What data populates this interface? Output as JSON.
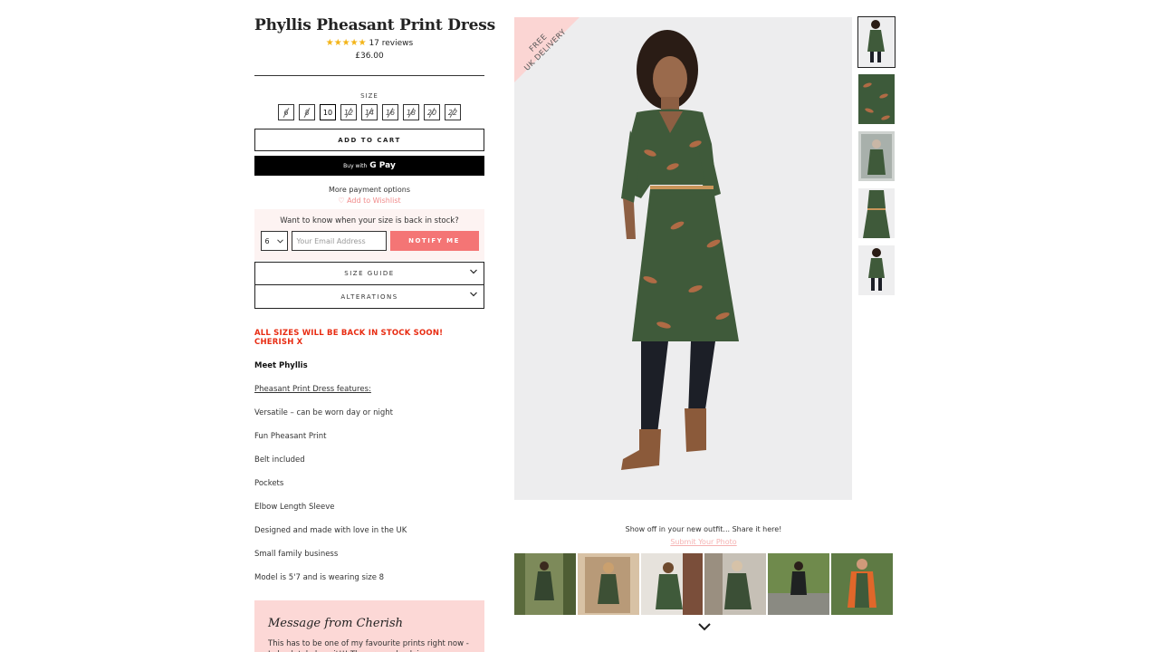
{
  "product": {
    "title": "Phyllis Pheasant Print Dress",
    "stars": "★★★★★",
    "reviews": "17 reviews",
    "price": "£36.00"
  },
  "size": {
    "label": "SIZE",
    "options": [
      {
        "label": "6",
        "available": false
      },
      {
        "label": "8",
        "available": false
      },
      {
        "label": "10",
        "available": true,
        "selected": true
      },
      {
        "label": "12",
        "available": false
      },
      {
        "label": "14",
        "available": false
      },
      {
        "label": "16",
        "available": false
      },
      {
        "label": "18",
        "available": false
      },
      {
        "label": "20",
        "available": false
      },
      {
        "label": "22",
        "available": false
      }
    ]
  },
  "buttons": {
    "add_to_cart": "ADD TO CART",
    "buy_with": "Buy with",
    "gpay": "G Pay",
    "more_payment": "More payment options",
    "wishlist": "♡ Add to Wishlist"
  },
  "notify": {
    "question": "Want to know when your size is back in stock?",
    "selected_size": "6",
    "email_placeholder": "Your Email Address",
    "button": "NOTIFY ME"
  },
  "accordions": {
    "size_guide": "SIZE GUIDE",
    "alterations": "ALTERATIONS"
  },
  "description": {
    "restock": "ALL SIZES WILL BE BACK IN STOCK SOON! CHERISH X",
    "meet": "Meet Phyllis",
    "features_heading": "Pheasant Print Dress features:",
    "features": [
      "Versatile – can be worn day or night",
      "Fun Pheasant Print",
      "Belt included",
      "Pockets",
      "Elbow Length Sleeve",
      "Designed and made with love in the UK",
      "Small family business",
      "Model is 5'7 and is wearing size 8"
    ]
  },
  "message": {
    "title": "Message from Cherish",
    "body": "This has to be one of my favourite prints right now - I absolutely love it!!! The green check is gorgeous and"
  },
  "banner": {
    "line1": "FREE",
    "line2": "UK DELIVERY"
  },
  "ugc": {
    "prompt": "Show off in your new outfit... Share it here!",
    "link": "Submit Your Photo"
  },
  "colors": {
    "dress_green": "#3f5a3a",
    "accent_pink": "#f47575",
    "restock_red": "#e82c12",
    "star_gold": "#f3b418"
  }
}
